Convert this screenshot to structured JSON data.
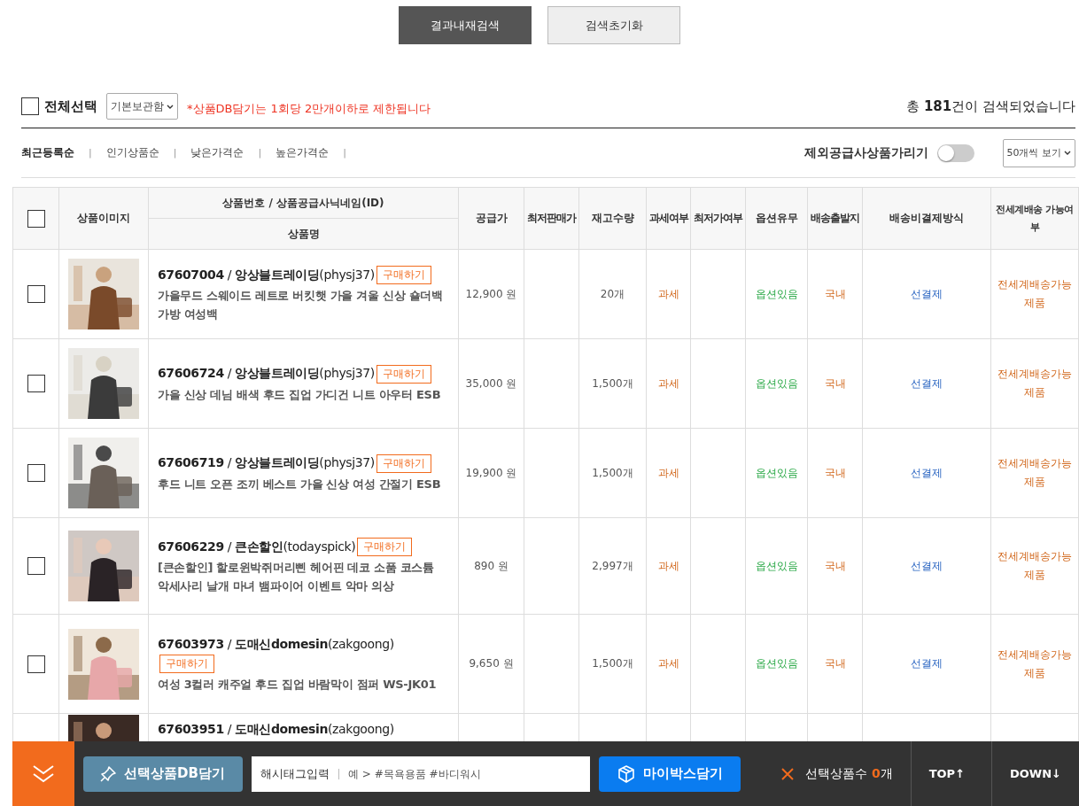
{
  "top_buttons": [
    {
      "label": "결과내재검색",
      "kind": "primary"
    },
    {
      "label": "검색초기화",
      "kind": "secondary"
    }
  ],
  "select_all": {
    "label": "전체선택",
    "checked": false
  },
  "folder_select": {
    "value": "기본보관함"
  },
  "notice": "*상품DB담기는 1회당 2만개이하로 제한됩니다",
  "result_count": "총 **181**건이 검색되었습니다",
  "sort_tabs": [
    {
      "label": "최근등록순",
      "selected": true
    },
    {
      "label": "인기상품순",
      "selected": false
    },
    {
      "label": "낮은가격순",
      "selected": false
    },
    {
      "label": "높은가격순",
      "selected": false
    }
  ],
  "separator": "|",
  "hide_excluded": {
    "label": "제외공급사상품가리기",
    "on": false
  },
  "page_size": {
    "value": "50개씩 보기"
  },
  "table": {
    "columns": {
      "image": "상품이미지",
      "product_top": "상품번호 / 상품공급사닉네임(ID)",
      "product_bottom": "상품명",
      "price": "공급가",
      "min_price": "최저판매가",
      "stock": "재고수량",
      "tax": "과세여부",
      "lowest": "최저가여부",
      "options": "옵션유무",
      "origin": "배송출발지",
      "payment": "배송비결제방식",
      "worldwide": "전세계배송 가능여부"
    },
    "header_checked": false,
    "rows": [
      {
        "selected": false,
        "buy": "구매하기",
        "title": "**67607004** / **앙상블트레이딩**(physj37)",
        "name": "가을무드 스웨이드 레트로 버킷햇 가을 겨울 신상 숄더백 가방 여성백",
        "price": "12,900 원",
        "stock": "20개",
        "tax": "과세",
        "options": "옵션있음",
        "origin": "국내",
        "payment": "선결제",
        "worldwide": "전세계배송가능제품"
      },
      {
        "selected": false,
        "buy": "구매하기",
        "title": "**67606724** / **앙상블트레이딩**(physj37)",
        "name": "가을 신상 데님 배색 후드 집업 가디건 니트 아우터 ESB",
        "price": "35,000 원",
        "stock": "1,500개",
        "tax": "과세",
        "options": "옵션있음",
        "origin": "국내",
        "payment": "선결제",
        "worldwide": "전세계배송가능제품"
      },
      {
        "selected": false,
        "buy": "구매하기",
        "title": "**67606719** / **앙상블트레이딩**(physj37)",
        "name": "후드 니트 오픈 조끼 베스트 가을 신상 여성 간절기 ESB",
        "price": "19,900 원",
        "stock": "1,500개",
        "tax": "과세",
        "options": "옵션있음",
        "origin": "국내",
        "payment": "선결제",
        "worldwide": "전세계배송가능제품"
      },
      {
        "selected": false,
        "buy": "구매하기",
        "title": "**67606229** / **큰손할인**(todayspick)",
        "name": "[큰손할인] 할로윈박쥐머리삔 헤어핀 데코 소품 코스튬 악세사리 날개 마녀 뱀파이어 이벤트 악마 의상",
        "price": "890 원",
        "stock": "2,997개",
        "tax": "과세",
        "options": "옵션있음",
        "origin": "국내",
        "payment": "선결제",
        "worldwide": "전세계배송가능제품"
      },
      {
        "selected": false,
        "buy": "구매하기",
        "title": "**67603973** / **도매신domesin**(zakgoong)",
        "name": "여성 3컬러 캐주얼 후드 집업 바람막이 점퍼 WS-JK01",
        "price": "9,650 원",
        "stock": "1,500개",
        "tax": "과세",
        "options": "옵션있음",
        "origin": "국내",
        "payment": "선결제",
        "worldwide": "전세계배송가능제품"
      },
      {
        "kind": "partial",
        "title": "**67603951** / **도매신domesin**(zakgoong)"
      }
    ]
  },
  "bottom_bar": {
    "db_button": "선택상품DB담기",
    "hashtag_label": "해시태그입력",
    "hashtag_placeholder": "예 > #목욕용품 #바디워시",
    "mybox_button": "마이박스담기",
    "selected_count": "선택상품수 **0**개",
    "top": "TOP↑",
    "down": "DOWN↓"
  }
}
